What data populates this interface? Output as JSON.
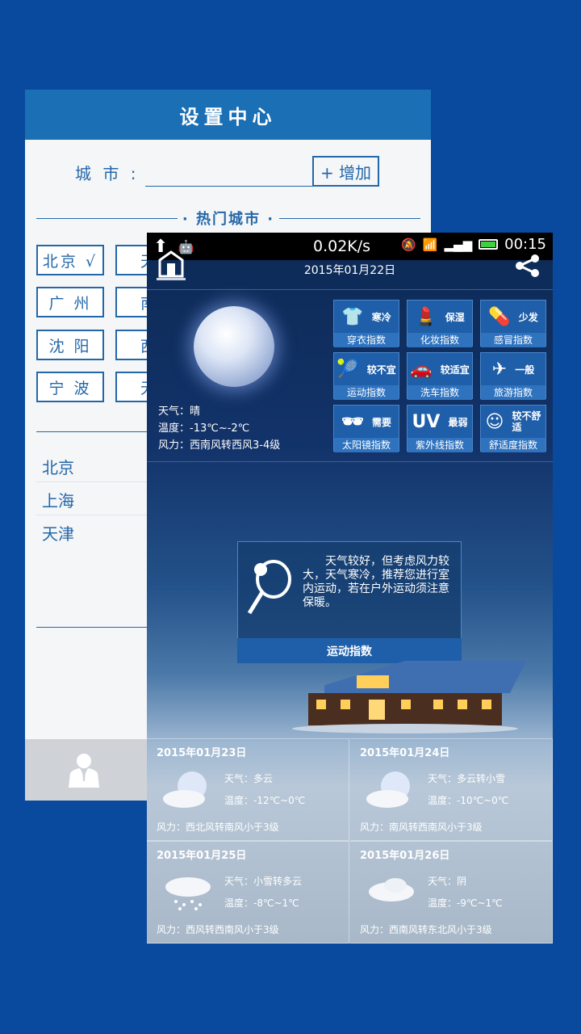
{
  "settings": {
    "title": "设置中心",
    "city_label": "城 市 :",
    "city_value": "",
    "add_button": "+ 增加",
    "hot_title": "· 热门城市 ·",
    "hot_cities": [
      "北京 √",
      "天",
      "广 州",
      "南",
      "沈 阳",
      "西",
      "宁 波",
      "无"
    ],
    "saved_cities": [
      "北京",
      "上海",
      "天津"
    ]
  },
  "weather": {
    "status_time": "00:15",
    "status_speed": "0.02K/s",
    "date": "2015年01月22日",
    "today": {
      "weather": "天气：晴",
      "temp": "温度：-13℃~-2℃",
      "wind": "风力：西南风转西风3-4级"
    },
    "indexes": [
      {
        "icon": "👕",
        "value": "寒冷",
        "label": "穿衣指数"
      },
      {
        "icon": "💄",
        "value": "保湿",
        "label": "化妆指数"
      },
      {
        "icon": "💊",
        "value": "少发",
        "label": "感冒指数"
      },
      {
        "icon": "🎾",
        "value": "较不宜",
        "label": "运动指数"
      },
      {
        "icon": "🚗",
        "value": "较适宜",
        "label": "洗车指数"
      },
      {
        "icon": "✈",
        "value": "一般",
        "label": "旅游指数"
      },
      {
        "icon": "🕶",
        "value": "需要",
        "label": "太阳镜指数"
      },
      {
        "icon": "UV",
        "value": "最弱",
        "label": "紫外线指数"
      },
      {
        "icon": "☺",
        "value": "较不舒适",
        "label": "舒适度指数"
      }
    ],
    "tip": {
      "text": "天气较好，但考虑风力较大，天气寒冷，推荐您进行室内运动，若在户外运动须注意保暖。",
      "footer": "运动指数"
    },
    "forecast": [
      {
        "date": "2015年01月23日",
        "weather": "天气：多云",
        "temp": "温度：-12℃~0℃",
        "wind": "风力：西北风转南风小于3级",
        "icon": "partly-cloudy-night-icon"
      },
      {
        "date": "2015年01月24日",
        "weather": "天气：多云转小雪",
        "temp": "温度：-10℃~0℃",
        "wind": "风力：南风转西南风小于3级",
        "icon": "partly-cloudy-night-icon"
      },
      {
        "date": "2015年01月25日",
        "weather": "天气：小雪转多云",
        "temp": "温度：-8℃~1℃",
        "wind": "风力：西风转西南风小于3级",
        "icon": "snow-cloud-icon"
      },
      {
        "date": "2015年01月26日",
        "weather": "天气：阴",
        "temp": "温度：-9℃~1℃",
        "wind": "风力：西南风转东北风小于3级",
        "icon": "overcast-cloud-icon"
      }
    ]
  }
}
